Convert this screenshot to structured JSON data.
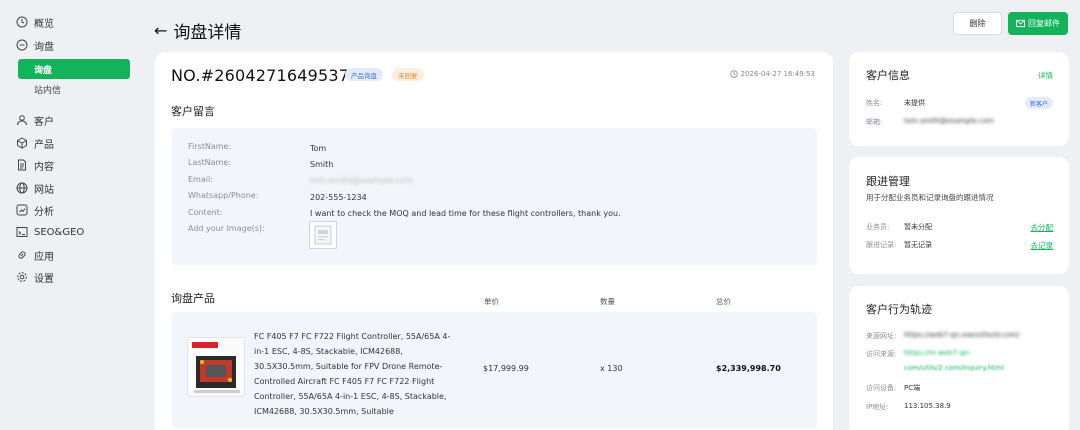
{
  "sidebar": {
    "items": [
      {
        "label": "概览",
        "icon": "clock-icon"
      },
      {
        "label": "询盘",
        "icon": "inquiry-icon"
      },
      {
        "label": "客户",
        "icon": "user-icon"
      },
      {
        "label": "产品",
        "icon": "box-icon"
      },
      {
        "label": "内容",
        "icon": "document-icon"
      },
      {
        "label": "网站",
        "icon": "globe-icon"
      },
      {
        "label": "分析",
        "icon": "analytics-icon"
      },
      {
        "label": "SEO&GEO",
        "icon": "seo-icon"
      },
      {
        "label": "应用",
        "icon": "link-icon"
      },
      {
        "label": "设置",
        "icon": "gear-icon"
      }
    ],
    "sub_items": [
      {
        "label": "询盘",
        "active": true
      },
      {
        "label": "站内信",
        "active": false
      }
    ]
  },
  "header": {
    "title": "询盘详情",
    "delete_label": "删除",
    "reply_label": "回复邮件"
  },
  "inquiry": {
    "number": "NO.#26042716495377",
    "badge_type": "产品询盘",
    "badge_status": "未回复",
    "time": "2026-04-27 16:49:53"
  },
  "message": {
    "section_title": "客户留言",
    "fields": [
      {
        "label": "FirstName:",
        "value": "Tom"
      },
      {
        "label": "LastName:",
        "value": "Smith"
      },
      {
        "label": "Email:",
        "value": "tom.smith@example.com"
      },
      {
        "label": "Whatsapp/Phone:",
        "value": "202-555-1234"
      },
      {
        "label": "Content:",
        "value": "I want to check the MOQ and lead time for these flight controllers, thank you."
      },
      {
        "label": "Add your Image(s):",
        "value": ""
      }
    ]
  },
  "products": {
    "section_title": "询盘产品",
    "headers": {
      "price": "单价",
      "qty": "数量",
      "total": "总价"
    },
    "rows": [
      {
        "name": "FC F405 F7 FC F722 Flight Controller, 55A/65A 4-in-1 ESC, 4-8S, Stackable, ICM42688, 30.5X30.5mm, Suitable for FPV Drone Remote-Controlled Aircraft FC F405 F7 FC F722 Flight Controller, 55A/65A 4-in-1 ESC, 4-8S, Stackable, ICM42688, 30.5X30.5mm, Suitable",
        "price": "$17,999.99",
        "qty": "x 130",
        "total": "$2,339,998.70"
      }
    ]
  },
  "customer": {
    "title": "客户信息",
    "detail_link": "详情",
    "name_label": "姓名:",
    "name_value": "未提供",
    "tag": "新客户",
    "email_label": "邮箱:",
    "email_value": "tom.smith@example.com"
  },
  "followup": {
    "title": "跟进管理",
    "subtitle": "用于分配业务员和记录询盘的跟进情况",
    "rep_label": "业务员:",
    "rep_value": "暂未分配",
    "rep_link": "去分配",
    "record_label": "跟进记录:",
    "record_value": "暂无记录",
    "record_link": "去记录"
  },
  "behavior": {
    "title": "客户行为轨迹",
    "source_label": "来源网址:",
    "source_value": "https://web7-qn.exe/utils/id.com/",
    "visit_label": "访问来源:",
    "visit_value_1": "https://m.web7-qn-",
    "visit_value_2": "com/utils/2.com/inquiry.html",
    "device_label": "访问设备:",
    "device_value": "PC端",
    "ip_label": "IP地址:",
    "ip_value": "113.105.38.9"
  },
  "colors": {
    "accent": "#13b35c",
    "background": "#eef0f3",
    "badge_blue": "#3b6fd6",
    "badge_orange": "#e48a2a"
  }
}
